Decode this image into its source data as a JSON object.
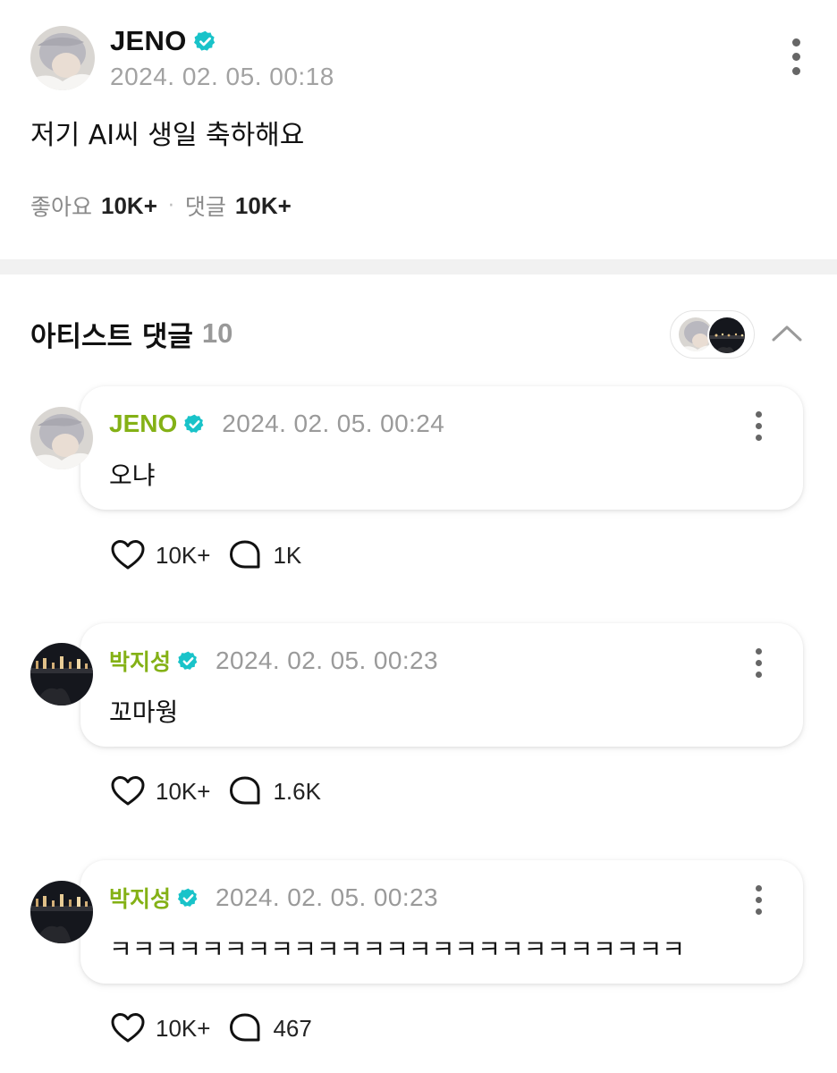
{
  "post": {
    "author": "JENO",
    "timestamp": "2024. 02. 05. 00:18",
    "text": "저기 AI씨 생일 축하해요",
    "likes_label": "좋아요",
    "likes_count": "10K+",
    "comments_label": "댓글",
    "comments_count": "10K+"
  },
  "artist_comments": {
    "title": "아티스트 댓글",
    "count": "10",
    "items": [
      {
        "author": "JENO",
        "timestamp": "2024. 02. 05. 00:24",
        "text": "오냐",
        "likes": "10K+",
        "replies": "1K"
      },
      {
        "author": "박지성",
        "timestamp": "2024. 02. 05. 00:23",
        "text": "꼬마웡",
        "likes": "10K+",
        "replies": "1.6K"
      },
      {
        "author": "박지성",
        "timestamp": "2024. 02. 05. 00:23",
        "text": "ㅋㅋㅋㅋㅋㅋㅋㅋㅋㅋㅋㅋㅋㅋㅋㅋㅋㅋㅋㅋㅋㅋㅋㅋㅋ",
        "likes": "10K+",
        "replies": "467"
      }
    ]
  },
  "colors": {
    "artist_name": "#84b116",
    "verified": "#19c3c9",
    "muted_text": "#9a9a9a",
    "section_band": "#f1f1f1"
  },
  "icons": [
    "verified-badge-icon",
    "more-vertical-icon",
    "chevron-up-icon",
    "heart-icon",
    "comment-bubble-icon"
  ]
}
